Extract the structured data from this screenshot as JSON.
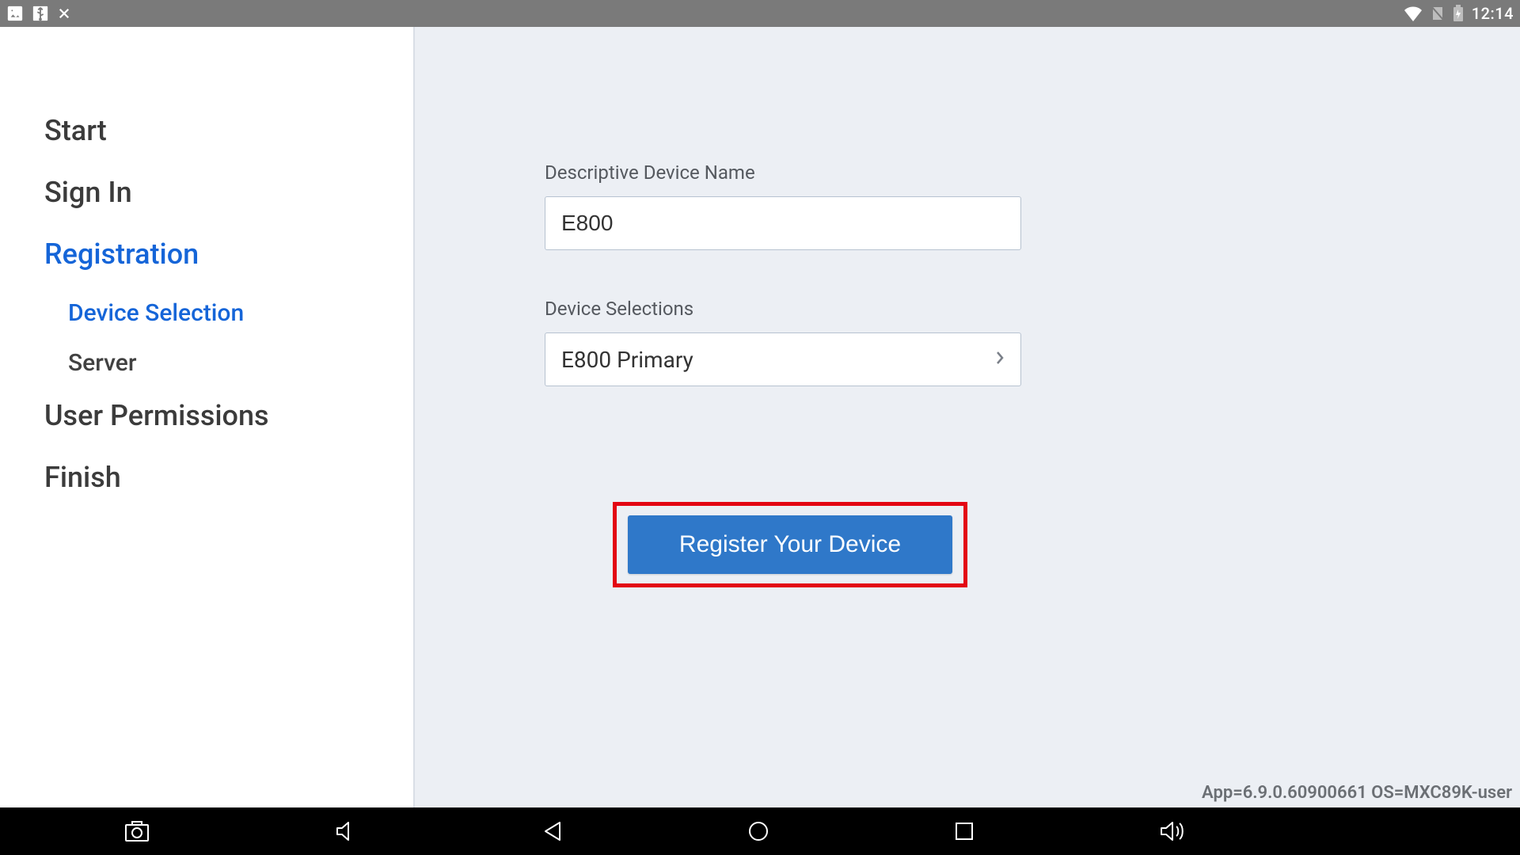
{
  "status": {
    "time": "12:14"
  },
  "sidebar": {
    "items": [
      {
        "label": "Start",
        "active": false
      },
      {
        "label": "Sign In",
        "active": false
      },
      {
        "label": "Registration",
        "active": true
      },
      {
        "label": "User Permissions",
        "active": false
      },
      {
        "label": "Finish",
        "active": false
      }
    ],
    "sub_items": [
      {
        "label": "Device Selection",
        "active": true
      },
      {
        "label": "Server",
        "active": false
      }
    ]
  },
  "form": {
    "device_name_label": "Descriptive Device Name",
    "device_name_value": "E800",
    "device_selection_label": "Device Selections",
    "device_selection_value": "E800 Primary",
    "register_button": "Register Your Device"
  },
  "footer": {
    "version": "App=6.9.0.60900661 OS=MXC89K-user"
  }
}
